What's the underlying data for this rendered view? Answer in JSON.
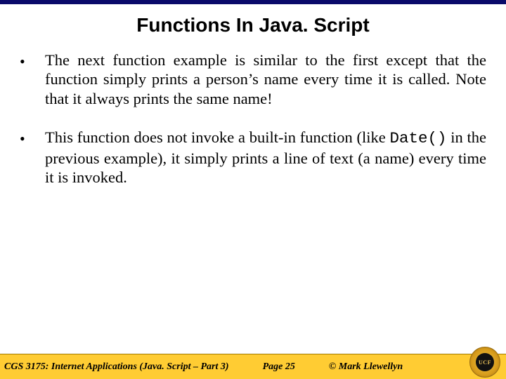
{
  "title": "Functions In Java. Script",
  "bullets": [
    {
      "text_pre": "The next function example is similar to the first except that the function simply prints a person’s name every time it is called.  Note that it always prints the same name!",
      "code": "",
      "text_post": ""
    },
    {
      "text_pre": "This function does not invoke a built-in function (like ",
      "code": "Date()",
      "text_post": " in the previous example), it simply prints a line of text (a name) every time it is invoked."
    }
  ],
  "footer": {
    "course": "CGS 3175: Internet Applications (Java. Script – Part 3)",
    "page": "Page 25",
    "copyright": "© Mark Llewellyn"
  },
  "logo_text": "UCF"
}
